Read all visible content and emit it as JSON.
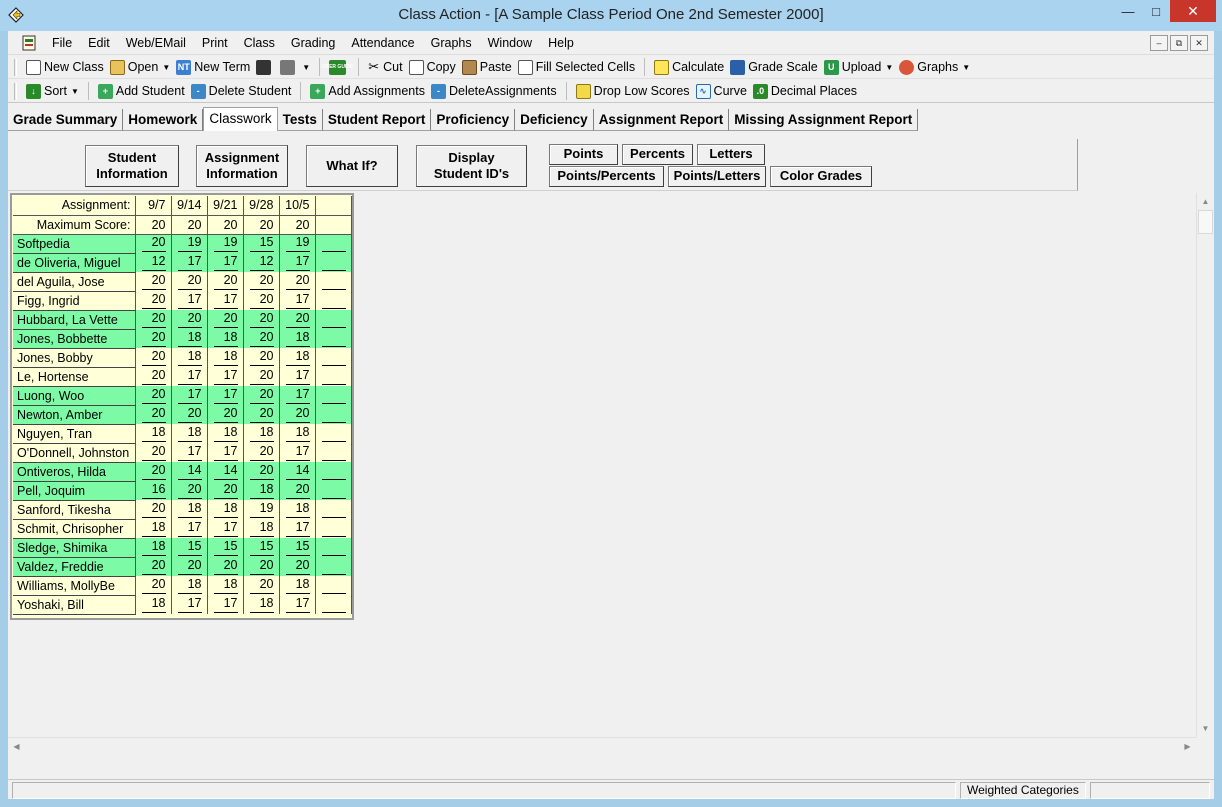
{
  "window": {
    "title": "Class Action - [A Sample Class Period One 2nd Semester 2000]"
  },
  "menu": [
    "File",
    "Edit",
    "Web/EMail",
    "Print",
    "Class",
    "Grading",
    "Attendance",
    "Graphs",
    "Window",
    "Help"
  ],
  "toolbar1": {
    "new_class": "New Class",
    "open": "Open",
    "new_term": "New Term",
    "cut": "Cut",
    "copy": "Copy",
    "paste": "Paste",
    "fill": "Fill Selected Cells",
    "calculate": "Calculate",
    "grade_scale": "Grade Scale",
    "upload": "Upload",
    "graphs": "Graphs",
    "user_guide_icon_text": "USER GUIDE"
  },
  "toolbar2": {
    "sort": "Sort",
    "add_student": "Add Student",
    "delete_student": "Delete Student",
    "add_assignments": "Add Assignments",
    "delete_assignments": "DeleteAssignments",
    "drop_low": "Drop Low Scores",
    "curve": "Curve",
    "decimal": "Decimal Places"
  },
  "tabs": [
    "Grade Summary",
    "Homework",
    "Classwork",
    "Tests",
    "Student Report",
    "Proficiency",
    "Deficiency",
    "Assignment Report",
    "Missing Assignment Report"
  ],
  "active_tab": "Classwork",
  "panel": {
    "student_info": [
      "Student",
      "Information"
    ],
    "assignment_info": [
      "Assignment",
      "Information"
    ],
    "what_if": "What If?",
    "display_ids": [
      "Display",
      "Student ID's"
    ],
    "points": "Points",
    "percents": "Percents",
    "letters": "Letters",
    "points_percents": "Points/Percents",
    "points_letters": "Points/Letters",
    "color_grades": "Color Grades"
  },
  "grid": {
    "assignment_label": "Assignment:",
    "max_label": "Maximum Score:",
    "assignments": [
      "9/7",
      "9/14",
      "9/21",
      "9/28",
      "10/5",
      ""
    ],
    "max_scores": [
      "20",
      "20",
      "20",
      "20",
      "20",
      ""
    ],
    "students": [
      {
        "name": "Softpedia",
        "scores": [
          "20",
          "19",
          "19",
          "15",
          "19"
        ],
        "highlight": true
      },
      {
        "name": "de Oliveria, Miguel",
        "scores": [
          "12",
          "17",
          "17",
          "12",
          "17"
        ],
        "highlight": true
      },
      {
        "name": "del Aguila, Jose",
        "scores": [
          "20",
          "20",
          "20",
          "20",
          "20"
        ],
        "highlight": false
      },
      {
        "name": "Figg, Ingrid",
        "scores": [
          "20",
          "17",
          "17",
          "20",
          "17"
        ],
        "highlight": false
      },
      {
        "name": "Hubbard, La Vette",
        "scores": [
          "20",
          "20",
          "20",
          "20",
          "20"
        ],
        "highlight": true
      },
      {
        "name": "Jones, Bobbette",
        "scores": [
          "20",
          "18",
          "18",
          "20",
          "18"
        ],
        "highlight": true
      },
      {
        "name": "Jones, Bobby",
        "scores": [
          "20",
          "18",
          "18",
          "20",
          "18"
        ],
        "highlight": false
      },
      {
        "name": "Le, Hortense",
        "scores": [
          "20",
          "17",
          "17",
          "20",
          "17"
        ],
        "highlight": false
      },
      {
        "name": "Luong, Woo",
        "scores": [
          "20",
          "17",
          "17",
          "20",
          "17"
        ],
        "highlight": true
      },
      {
        "name": "Newton, Amber",
        "scores": [
          "20",
          "20",
          "20",
          "20",
          "20"
        ],
        "highlight": true
      },
      {
        "name": "Nguyen, Tran",
        "scores": [
          "18",
          "18",
          "18",
          "18",
          "18"
        ],
        "highlight": false
      },
      {
        "name": "O'Donnell, Johnston",
        "scores": [
          "20",
          "17",
          "17",
          "20",
          "17"
        ],
        "highlight": false
      },
      {
        "name": "Ontiveros, Hilda",
        "scores": [
          "20",
          "14",
          "14",
          "20",
          "14"
        ],
        "highlight": true
      },
      {
        "name": "Pell, Joquim",
        "scores": [
          "16",
          "20",
          "20",
          "18",
          "20"
        ],
        "highlight": true
      },
      {
        "name": "Sanford, Tikesha",
        "scores": [
          "20",
          "18",
          "18",
          "19",
          "18"
        ],
        "highlight": false
      },
      {
        "name": "Schmit, Chrisopher",
        "scores": [
          "18",
          "17",
          "17",
          "18",
          "17"
        ],
        "highlight": false
      },
      {
        "name": "Sledge, Shimika",
        "scores": [
          "18",
          "15",
          "15",
          "15",
          "15"
        ],
        "highlight": true
      },
      {
        "name": "Valdez, Freddie",
        "scores": [
          "20",
          "20",
          "20",
          "20",
          "20"
        ],
        "highlight": true
      },
      {
        "name": "Williams, MollyBe",
        "scores": [
          "20",
          "18",
          "18",
          "20",
          "18"
        ],
        "highlight": false
      },
      {
        "name": "Yoshaki, Bill",
        "scores": [
          "18",
          "17",
          "17",
          "18",
          "17"
        ],
        "highlight": false
      }
    ]
  },
  "status": {
    "weighted": "Weighted Categories"
  },
  "colors": {
    "highlight_row": "#7dfaa6",
    "grid_bg": "#ffffd8",
    "titlebar": "#a9d3ef",
    "close_btn": "#c7352b"
  }
}
